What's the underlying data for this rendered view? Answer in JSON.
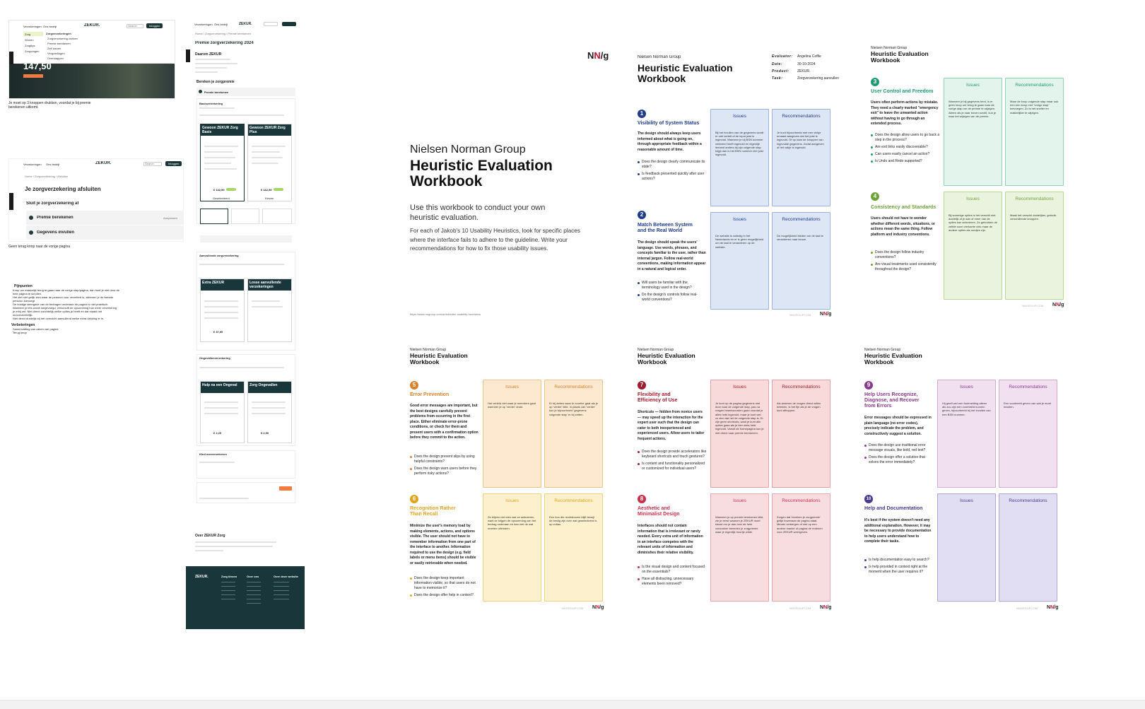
{
  "left": {
    "screen1": {
      "nav": [
        "Verzekeringen",
        "Ons bedrijf"
      ],
      "logo": "ZEKUR.",
      "search_label": "Search",
      "login_label": "Inloggen",
      "menu_col1": [
        "Zorg",
        "Wonen",
        "Zorgtips",
        "Zorgvragen"
      ],
      "menu_col2": [
        "Zorgverzekeringen",
        "Zorgverzekering zoeken",
        "Premie berekenen",
        "Zelf kiezen",
        "Vergoedingen",
        "Overstappen"
      ],
      "price": "147,50",
      "caption": "Je moet op 3 knoppen drukken, voordat je bij premie berekenen uitkomt."
    },
    "screen2": {
      "nav": [
        "Verzekeringen",
        "Ons bedrijf"
      ],
      "logo": "ZEKUR.",
      "search_label": "Search",
      "login_label": "Inloggen",
      "breadcrumb": "Home / Zorgverzekering / Afsluiten",
      "title": "Je zorgverzekering afsluiten",
      "subtitle": "Sluit je zorgverzekering af",
      "steps": [
        "Premie berekenen",
        "Gegevens invullen"
      ],
      "edit_label": "Aanpassen",
      "caption": "Geen terug knop naar de vorige pagina"
    },
    "notes": {
      "pijnpunten_title": "Pijnpunten",
      "pijnpunten": [
        "Knop om makkelijk terug te gaan naar de vorige stap/pagina, dan hoef je niet door de hele pagina te scrollen.",
        "Het ziet niet gelijk zien waar de persoon voor verzekert is, alleenen je de tweede persoon toevoegt",
        "De huidige weergave van de bedragen onderaan de pagina is niet praktisch. Wanneer je iets wordt toegevoegd, verschuift de opsomming hoe meer verzekering je erbij zet. Niet direct inzichtelijk welke opties je heeft en dat maakt het onoverzichtelijk.",
        "Niet direct duidelijk bij het overzicht aanvullend welke extra dekking er is."
      ],
      "verbeteringen_title": "Verbeteringen",
      "verbeteringen": [
        "Samenvatting van zaken van pagina",
        "Terug knop"
      ]
    },
    "page": {
      "nav": [
        "Verzekeringen",
        "Ons bedrijf"
      ],
      "logo": "ZEKUR.",
      "breadcrumb": "Home / Zorgverzekering / Premie berekenen",
      "title": "Premie zorgverzekering 2024",
      "lead": "Daarom ZEKUR",
      "calc_title": "Bereken je zorgpremie",
      "calc_step": "Premie berekenen",
      "basis_title": "Basisverzekering",
      "card_basis": "Gewoon ZEKUR Zorg Basis",
      "card_plus": "Gewoon ZEKUR Zorg Plus",
      "price_basis": "€ 142,50",
      "price_plus": "€ 162,50",
      "select_label": "Geselecteerd",
      "choose_label": "Kiezen",
      "aanvullend_title": "Aanvullende zorgverzekering",
      "card_extra": "Extra ZEKUR",
      "card_losse": "Losse aanvullende verzekeringen",
      "price_extra": "€ 37,95",
      "ongeval_title": "Ongevallenverzekering",
      "card_hulp": "Hulp na een Ongeval",
      "card_zorg_ong": "Zorg Ongevallen",
      "price_hulp": "€ 2,25",
      "price_zorg_ong": "€ 2,50",
      "kind_title": "Kind meeverzekeren",
      "next_label": "Verder",
      "about_title": "Over ZEKUR Zorg",
      "footer_logo": "ZEKUR.",
      "footer_cols": [
        "Zorg kiezen",
        "Over ons",
        "Over deze website"
      ]
    }
  },
  "cover": {
    "logo_n1": "N",
    "logo_n2": "N",
    "logo_slash": "/",
    "logo_g": "g",
    "org": "Nielsen Norman Group",
    "title_line1": "Heuristic Evaluation",
    "title_line2": "Workbook",
    "intro": "Use this workbook to conduct your own heuristic evaluation.",
    "body": "For each of Jakob's 10 Usability Heuristics, look for specific places where the interface fails to adhere to the guideline. Write your recommendations for how to fix those usability issues.",
    "url": "https://www.nngroup.com/articles/ten-usability-heuristics/"
  },
  "meta": {
    "labels": [
      "Evaluator:",
      "Date:",
      "Product:",
      "Task:"
    ],
    "values": [
      "Angelina Coffie",
      "30-10-2024",
      "ZEKUR.",
      "Zorgverzekering aanvullen"
    ]
  },
  "common": {
    "org": "Nielsen Norman Group",
    "title_line1": "Heuristic Evaluation",
    "title_line2": "Workbook",
    "issues": "Issues",
    "recommendations": "Recommendations",
    "footer": "NNGROUP.COM"
  },
  "heuristics": [
    {
      "n": "1",
      "title": "Visibility of System Status",
      "desc": "The design should always keep users informed about what is going on, through appropriate feedback within a reasonable amount of time.",
      "questions": [
        "Does the design clearly communicate its state?",
        "Is feedback presented quickly after user actions?"
      ],
      "issue": "Bij het invullen van de gegevens wordt er niet vertelt of de input juist is ingevuld. Wanneer je bij BSN nummer verkeerd heeft ingevuld en eigenlijk iemand anders bij zijn volgende stap krijgt dan is het BSN nummer niet juist ingevuld.",
      "rec": "Je kunt bijvoorbeeld met een vinkje ernaast aangeven dat het juist is ingevuld. Of op naar de knoppen van ingevulde gegevens. Zodat aangeven of het vakje is ingevuld."
    },
    {
      "n": "2",
      "title": "Match Between System and the Real World",
      "desc": "The design should speak the users' language. Use words, phrases, and concepts familiar to the user, rather than internal jargon. Follow real-world conventions, making information appear in a natural and logical order.",
      "questions": [
        "Will users be familiar with the terminology used in the design?",
        "Do the design's controls follow real-world conventions?"
      ],
      "issue": "De website is volledig in het Nederlands en er is geen mogelijkheid om de taal te veranderen op de website.",
      "rec": "De mogelijkheid bieden om de taal te veranderen naar keuze."
    },
    {
      "n": "3",
      "title": "User Control and Freedom",
      "desc": "Users often perform actions by mistake. They need a clearly marked \"emergency exit\" to leave the unwanted action without having to go through an extended process.",
      "questions": [
        "Does the design allow users to go back a step in the process?",
        "Are exit links easily discoverable?",
        "Can users easily cancel an action?",
        "Is Undo and Redo supported?"
      ],
      "issue": "Wanneer je bij gegevens bent, is er geen knop om terug te gaan naar de vorige stap om de premie te wijzigen. Alleen als je naar boven scrollt, kun je naar het wijzigen van de premie.",
      "rec": "Maar de knop volgende stap maar ook een een knop met \"vorige stap\" toevoegen. Zo is het sneller en makkelijker te wijzigen."
    },
    {
      "n": "4",
      "title": "Consistency and Standards",
      "desc": "Users should not have to wonder whether different words, situations, or actions mean the same thing. Follow platform and industry conventions.",
      "questions": [
        "Does the design follow industry conventions?",
        "Are visual treatments used consistently throughout the design?"
      ],
      "issue": "Bij sommige opties is het verschil niet duidelijk of je aan of meer van de opties kan selecteren. Ze gebruiken de zelfde soort vierkante vink maar de andere opties als rondjes zijn.",
      "rec": "Maak het verschil duidelijker, gebruik verschillende knoppen."
    },
    {
      "n": "5",
      "title": "Error Prevention",
      "desc": "Good error messages are important, but the best designs carefully prevent problems from occurring in the first place. Either eliminate error-prone conditions, or check for them and present users with a confirmation option before they commit to the action.",
      "questions": [
        "Does the design prevent slips by using helpful constraints?",
        "Does the design warn users before they perform risky actions?"
      ],
      "issue": "Het verleid niet waar je meerdere gaat wanneer je op 'verder' drukt.",
      "rec": "Er bij zetten waar le noorlire gaat als je op 'verder' klikt. In plaats van 'verder' kun je bijvoorbeeld 'gegevens volgende stap' er bij zetten."
    },
    {
      "n": "6",
      "title": "Recognition Rather Than Recall",
      "desc": "Minimize the user's memory load by making elements, actions, and options visible. The user should not have to remember information from one part of the interface to another. Information required to use the design (e.g. field labels or menu items) should be visible or easily retrievable when needed.",
      "questions": [
        "Does the design keep important information visible, so that users do not have to memorize it?",
        "Does the design offer help in context?"
      ],
      "issue": "Ze blijven niet zien wat ze selecteren, want ze krijgen de opsomming van het bedrag onderaan en dan niet de wat moeten uiteinden.",
      "rec": "Een bon die rechtsboven blijft terwijl de beslig zijn over wat geselecteerd is op voltau."
    },
    {
      "n": "7",
      "title": "Flexibility and Efficiency of Use",
      "desc": "Shortcuts — hidden from novice users — may speed up the interaction for the expert user such that the design can cater to both inexperienced and experienced users. Allow users to tailor frequent actions.",
      "questions": [
        "Does the design provide accelerators like keyboard shortcuts and touch gestures?",
        "Is content and functionality personalized or customized for individual users?"
      ],
      "issue": "Je kunt op de pagina gegevens niet door naar de volgende stap, pas na vragen beantwoorden gaan voordat je alles hebt ingevuld, maar je kunt wel zo zien dat het de volgende stap is. Er zijn geen shortcuts, want je kunt alle opties gaan als je hier niets hebt ingevuld. Vanuit de homepagina kun je niet direct naar premie berekenen.",
      "rec": "Als anderen de vragen direct willen beteken, is het fijn als je de vragen kunt afhoppen."
    },
    {
      "n": "8",
      "title": "Aesthetic and Minimalist Design",
      "desc": "Interfaces should not contain information that is irrelevant or rarely needed. Every extra unit of information in an interface competes with the relevant units of information and diminishes their relative visibility.",
      "questions": [
        "Is the visual design and content focused on the essentials?",
        "Have all distracting, unnecessary elements been removed?"
      ],
      "issue": "Wanneer je op premie berekenen klikt, zie je eerst waarom je ZEKUR moet kiezen en je dan over de hele zoezoeker beneden je zorgpremie waar je eigenlijk hoortje wilde.",
      "rec": "Zorgen dat 'bereken je zorgpremie' gelijk bovenaan de pagina staat. Minder verbergen of niet op een andere manier of pagina de redenen voor ZEKUR weergeven."
    },
    {
      "n": "9",
      "title": "Help Users Recognize, Diagnose, and Recover from Errors",
      "desc": "Error messages should be expressed in plain language (no error codes), precisely indicate the problem, and constructively suggest a solution.",
      "questions": [
        "Does the design use traditional error message visuals, like bold, red text?",
        "Does the design offer a solution that solves the error immediately?"
      ],
      "issue": "Hij geeft wel een foutmelding alleen als zou zijn een voorbeeld kunnen geven, bijvoorbeeld bij het invullen van een BSN nummer.",
      "rec": "Een voorbeeld geven van wat je moet invullen."
    },
    {
      "n": "10",
      "title": "Help and Documentation",
      "desc": "It's best if the system doesn't need any additional explanation. However, it may be necessary to provide documentation to help users understand how to complete their tasks.",
      "questions": [
        "Is help documentation easy to search?",
        "Is help provided in context right at the moment when the user requires it?"
      ],
      "issue": "",
      "rec": ""
    }
  ],
  "colors": {
    "h1": "#1f3c8a",
    "h1_box_bg": "#dce6f5",
    "h1_box_border": "#9ab3da",
    "h3": "#1d9c74",
    "h3_box_bg": "#e2f4ec",
    "h3_box_border": "#8fd1b3",
    "h4": "#6ea33a",
    "h4_box_bg": "#eaf3dd",
    "h4_box_border": "#b8d894",
    "h5": "#d9822b",
    "h5_box_bg": "#fde9cf",
    "h5_box_border": "#efc48b",
    "h6": "#e2a41e",
    "h6_box_bg": "#fdf0cc",
    "h6_box_border": "#f1d17f",
    "h7": "#a01b2c",
    "h7_box_bg": "#f9dada",
    "h7_box_border": "#e3a1a4",
    "h8": "#c9304a",
    "h8_box_bg": "#f8dde0",
    "h8_box_border": "#e8a6ae",
    "h9": "#8b3a8d",
    "h9_box_bg": "#f1e0f0",
    "h9_box_border": "#d3a9d2",
    "h10": "#4b3a8e",
    "h10_box_bg": "#e1ddf2",
    "h10_box_border": "#aea6d8"
  }
}
